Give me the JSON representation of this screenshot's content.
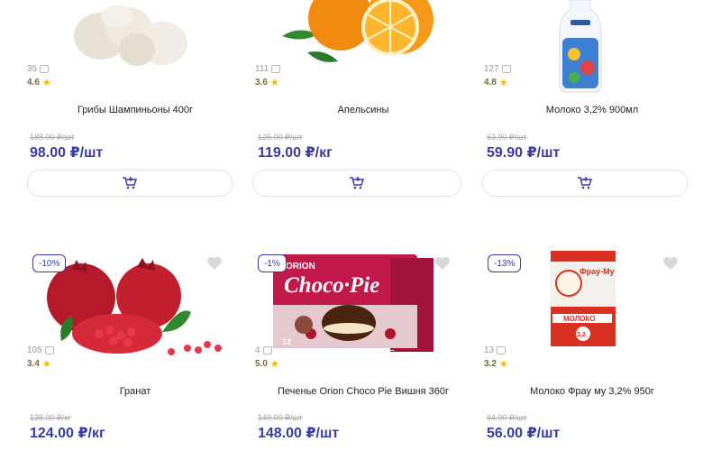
{
  "products": [
    {
      "name": "Грибы Шампиньоны 400г",
      "reviews": "35",
      "rating": "4.6",
      "old_price": "188.00 ₽/шт",
      "price": "98.00 ₽/шт"
    },
    {
      "name": "Апельсины",
      "reviews": "111",
      "rating": "3.6",
      "old_price": "125.00 ₽/шт",
      "price": "119.00 ₽/кг"
    },
    {
      "name": "Молоко 3,2% 900мл",
      "reviews": "127",
      "rating": "4.8",
      "old_price": "63.90 ₽/шт",
      "price": "59.90 ₽/шт"
    },
    {
      "name": "Гранат",
      "reviews": "105",
      "rating": "3.4",
      "discount": "-10%",
      "old_price": "138.00 ₽/кг",
      "price": "124.00 ₽/кг"
    },
    {
      "name": "Печенье Orion Choco Pie Вишня 360г",
      "reviews": "4",
      "rating": "5.0",
      "discount": "-1%",
      "old_price": "149.00 ₽/шт",
      "price": "148.00 ₽/шт",
      "box_brand": "ORION",
      "box_title": "Choco·Pie",
      "box_count": "12"
    },
    {
      "name": "Молоко Фрау му 3,2% 950г",
      "reviews": "13",
      "rating": "3.2",
      "discount": "-13%",
      "old_price": "64.00 ₽/шт",
      "price": "56.00 ₽/шт",
      "pack_brand": "Фрау-Му",
      "pack_label": "МОЛОКО",
      "pack_fat": "3,2"
    }
  ]
}
